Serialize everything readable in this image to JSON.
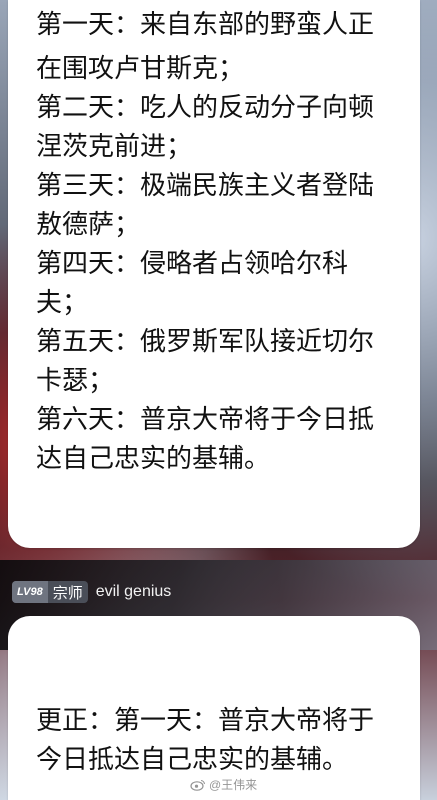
{
  "message_1": {
    "lines": [
      "第一天：来自东部的野蛮人正",
      "在围攻卢甘斯克；",
      "第二天：吃人的反动分子向顿",
      "涅茨克前进；",
      "第三天：极端民族主义者登陆",
      "敖德萨；",
      "第四天：侵略者占领哈尔科",
      "夫；",
      "第五天：俄罗斯军队接近切尔",
      "卡瑟；",
      "第六天：普京大帝将于今日抵",
      "达自己忠实的基辅。"
    ]
  },
  "user": {
    "level": "LV98",
    "rank": "宗师",
    "name": "evil genius"
  },
  "message_2": {
    "lines": [
      "更正：第一天：普京大帝将于",
      "今日抵达自己忠实的基辅。"
    ]
  },
  "watermark": {
    "text": "@王伟来"
  }
}
